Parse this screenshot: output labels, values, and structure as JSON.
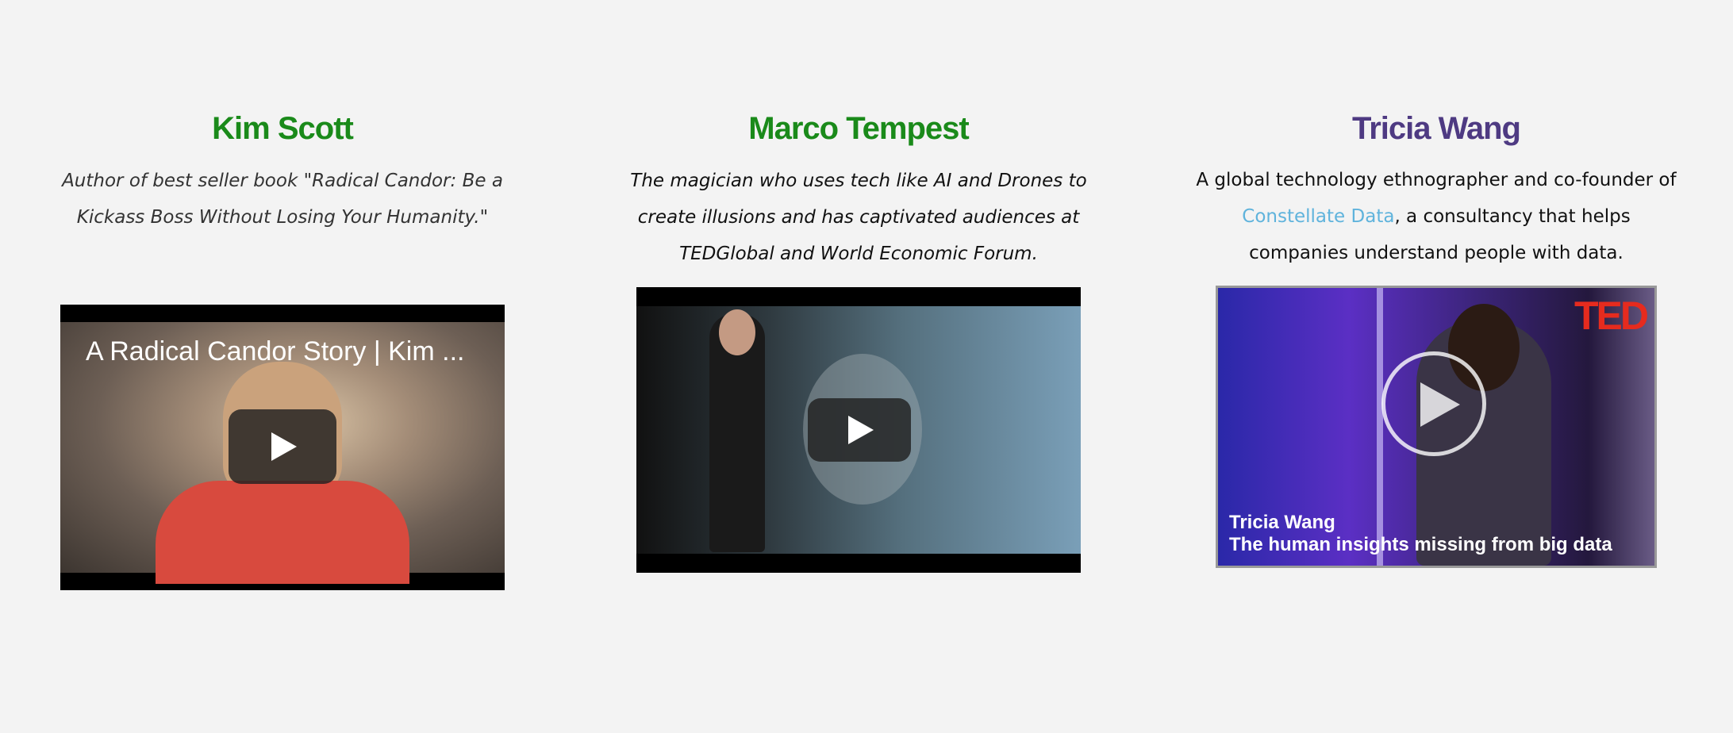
{
  "speakers": [
    {
      "name": "Kim Scott",
      "name_color": "#1a8a1a",
      "description": "Author of best seller book \"Radical Candor: Be a Kickass Boss Without Losing Your Humanity.\"",
      "video": {
        "title": "A Radical Candor Story | Kim ...",
        "play_icon": "play-icon"
      }
    },
    {
      "name": "Marco Tempest",
      "name_color": "#1a8a1a",
      "description": "The magician who uses tech like AI and Drones to create illusions and has captivated audiences at TEDGlobal and World Economic Forum.",
      "video": {
        "play_icon": "play-icon"
      }
    },
    {
      "name": "Tricia Wang",
      "name_color": "#4e3a82",
      "description_before": "A global technology ethnographer and co-founder of ",
      "link_text": "Constellate Data",
      "description_after": ", a consultancy that  helps companies understand people with data.",
      "video": {
        "logo": "TED",
        "caption_name": "Tricia Wang",
        "caption_title": "The human insights missing from big data",
        "play_icon": "play-circle-icon"
      }
    }
  ]
}
